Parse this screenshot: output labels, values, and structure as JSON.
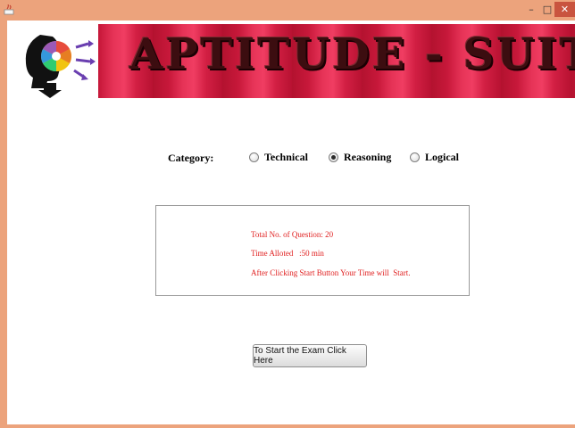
{
  "window": {
    "minimize_glyph": "–",
    "maximize_glyph": "□",
    "close_glyph": "✕"
  },
  "banner": {
    "title": "APTITUDE - SUITE",
    "logo_icon": "rainbow-head-logo"
  },
  "category": {
    "label": "Category:",
    "options": [
      {
        "label": "Technical",
        "selected": false
      },
      {
        "label": "Reasoning",
        "selected": true
      },
      {
        "label": "Logical",
        "selected": false
      }
    ]
  },
  "info": {
    "total_questions": "Total No. of Question: 20",
    "time_alloted": "Time Alloted   :50 min",
    "instruction": "After Clicking Start Button Your Time will  Start."
  },
  "start_button": {
    "label": "To Start the Exam Click Here"
  },
  "colors": {
    "frame": "#eca37c",
    "banner_red": "#d21f43",
    "info_text": "#e02020"
  }
}
